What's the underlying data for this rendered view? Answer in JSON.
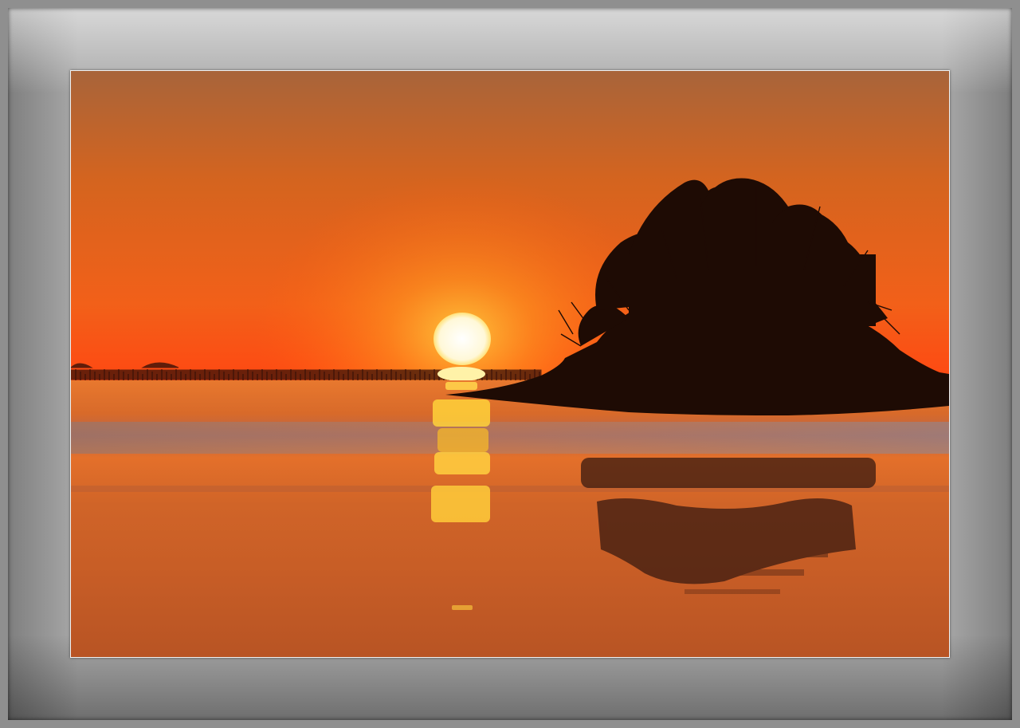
{
  "scene": {
    "colors": {
      "sky_top": "#a8643a",
      "sky_mid": "#f06a1e",
      "sky_horizon": "#ff4a12",
      "sun": "#fffbe6",
      "water_light": "#e8742a",
      "water_dark": "#b85428",
      "silhouette": "#1e0b04"
    }
  }
}
